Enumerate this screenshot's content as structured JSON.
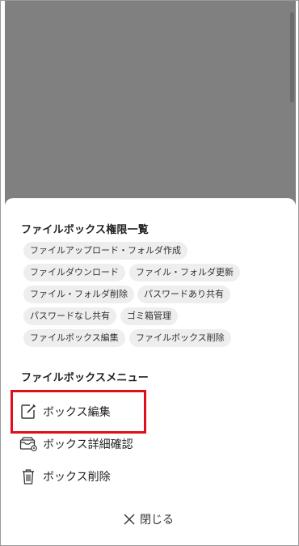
{
  "permissions": {
    "title": "ファイルボックス権限一覧",
    "chips": [
      "ファイルアップロード・フォルダ作成",
      "ファイルダウンロード",
      "ファイル・フォルダ更新",
      "ファイル・フォルダ削除",
      "パスワードあり共有",
      "パスワードなし共有",
      "ゴミ箱管理",
      "ファイルボックス編集",
      "ファイルボックス削除"
    ]
  },
  "menu": {
    "title": "ファイルボックスメニュー",
    "items": [
      {
        "label": "ボックス編集",
        "icon": "edit-icon"
      },
      {
        "label": "ボックス詳細確認",
        "icon": "box-details-icon"
      },
      {
        "label": "ボックス削除",
        "icon": "trash-icon"
      }
    ]
  },
  "close_label": "閉じる",
  "colors": {
    "overlay": "#808080",
    "chip_bg": "#eeeeee",
    "highlight": "#e0101a"
  }
}
